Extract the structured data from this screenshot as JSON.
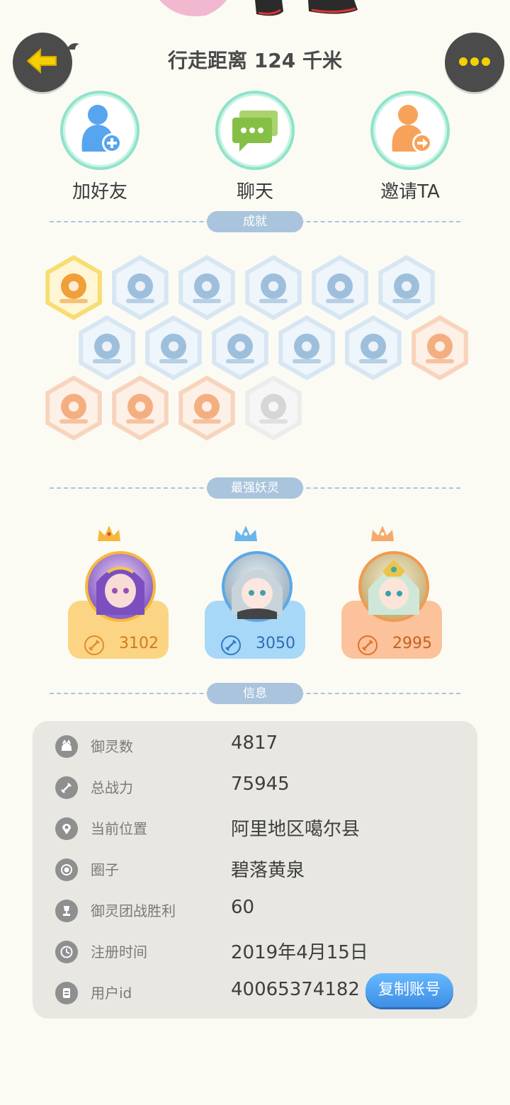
{
  "header": {
    "title": "行走距离 124 千米"
  },
  "actions": [
    {
      "label": "加好友",
      "icon": "add-friend-icon"
    },
    {
      "label": "聊天",
      "icon": "chat-icon"
    },
    {
      "label": "邀请TA",
      "icon": "invite-icon"
    }
  ],
  "sections": {
    "achievements": "成就",
    "top_spirits": "最强妖灵",
    "info": "信息"
  },
  "achievements": [
    {
      "icon": "fox-medal-icon",
      "tone": "gold"
    },
    {
      "icon": "sneaker-icon",
      "tone": "blue"
    },
    {
      "icon": "orb-stand-icon",
      "tone": "blue"
    },
    {
      "icon": "crystal-ball-icon",
      "tone": "blue"
    },
    {
      "icon": "yin-yang-scroll-icon",
      "tone": "blue"
    },
    {
      "icon": "spirit-statue-icon",
      "tone": "blue"
    },
    {
      "icon": "cat-wand-icon",
      "tone": "blue"
    },
    {
      "icon": "yin-yang-book-icon",
      "tone": "blue"
    },
    {
      "icon": "shield-orb-icon",
      "tone": "blue"
    },
    {
      "icon": "cat-silhouette-icon",
      "tone": "blue"
    },
    {
      "icon": "fox-book-icon",
      "tone": "blue"
    },
    {
      "icon": "moon-eclipse-icon",
      "tone": "orange"
    },
    {
      "icon": "crystal-gem-icon",
      "tone": "orange"
    },
    {
      "icon": "cart-cat-icon",
      "tone": "orange"
    },
    {
      "icon": "ox-spirit-icon",
      "tone": "orange"
    },
    {
      "icon": "dancing-spirit-icon",
      "tone": "grey"
    }
  ],
  "top_spirits": [
    {
      "score": "3102",
      "theme": "gold"
    },
    {
      "score": "3050",
      "theme": "blue"
    },
    {
      "score": "2995",
      "theme": "orange"
    }
  ],
  "info": [
    {
      "icon": "spirit-count-icon",
      "label": "御灵数",
      "value": "4817"
    },
    {
      "icon": "power-icon",
      "label": "总战力",
      "value": "75945"
    },
    {
      "icon": "location-pin-icon",
      "label": "当前位置",
      "value": "阿里地区噶尔县"
    },
    {
      "icon": "circle-icon",
      "label": "圈子",
      "value": "碧落黄泉"
    },
    {
      "icon": "trophy-icon",
      "label": "御灵团战胜利",
      "value": "60"
    },
    {
      "icon": "clock-icon",
      "label": "注册时间",
      "value": "2019年4月15日"
    },
    {
      "icon": "id-card-icon",
      "label": "用户id",
      "value": "40065374182"
    }
  ],
  "copy_button": "复制账号",
  "colors": {
    "background": "#fbfbf4",
    "accent_blue": "#4a9ff0",
    "gold": "#f7c34e",
    "blue_card": "#8ecdf6",
    "orange_card": "#f9b58c"
  }
}
